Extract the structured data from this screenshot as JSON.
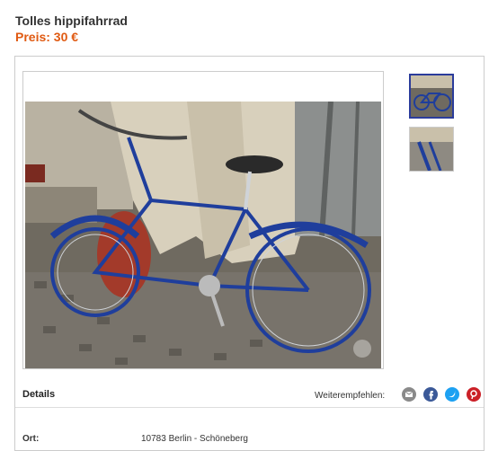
{
  "listing": {
    "title": "Tolles hippifahrrad",
    "price": "Preis: 30 €"
  },
  "details": {
    "heading": "Details",
    "share_label": "Weiterempfehlen:",
    "share_icons": [
      "email-icon",
      "facebook-icon",
      "twitter-icon",
      "pinterest-icon"
    ],
    "rows": [
      {
        "label": "Ort:",
        "value": "10783 Berlin - Schöneberg"
      }
    ]
  },
  "colors": {
    "price": "#e05a12",
    "thumb_active_border": "#2b3c9b",
    "email": "#8a8a8a",
    "facebook": "#3b5998",
    "twitter": "#1da1f2",
    "pinterest": "#cb2027"
  }
}
